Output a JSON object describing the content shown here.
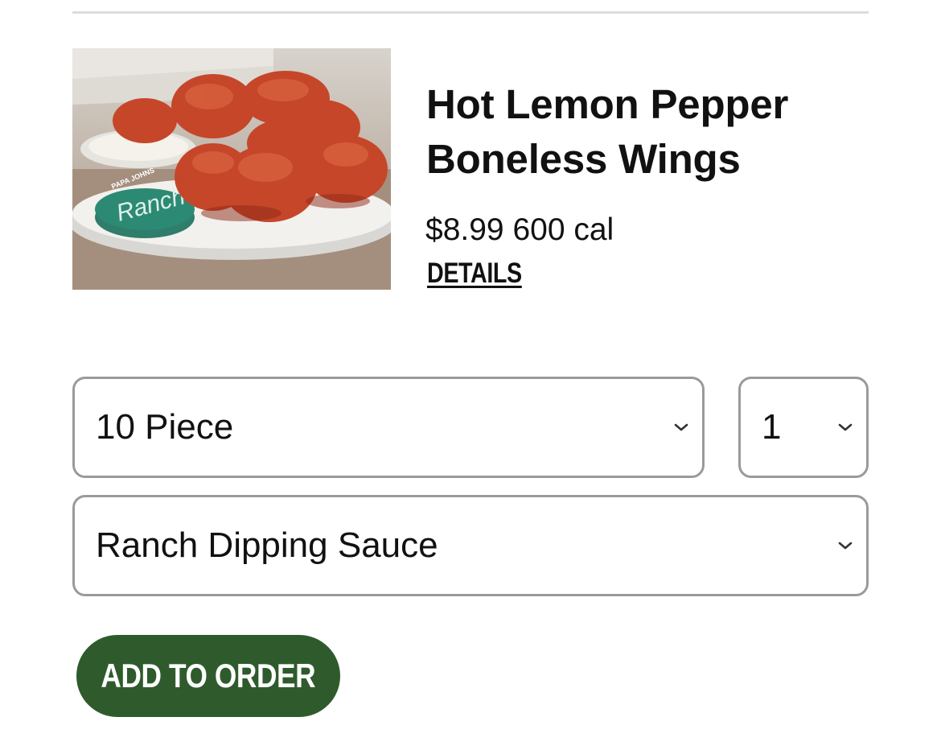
{
  "product": {
    "name": "Hot Lemon Pepper Boneless Wings",
    "price": "$8.99",
    "calories": "600 cal",
    "details_label": "DETAILS",
    "image_alt": "Hot Lemon Pepper Boneless Wings",
    "sauce_cup_brand": "PAPA JOHNS",
    "sauce_cup_label": "Ranch"
  },
  "options": {
    "size": {
      "selected": "10 Piece"
    },
    "quantity": {
      "selected": "1"
    },
    "sauce": {
      "selected": "Ranch Dipping Sauce"
    }
  },
  "actions": {
    "add_to_order": "ADD TO ORDER"
  },
  "colors": {
    "button_green": "#2f5b2c",
    "border_gray": "#9a9a9a",
    "divider_gray": "#dcdcdc"
  }
}
